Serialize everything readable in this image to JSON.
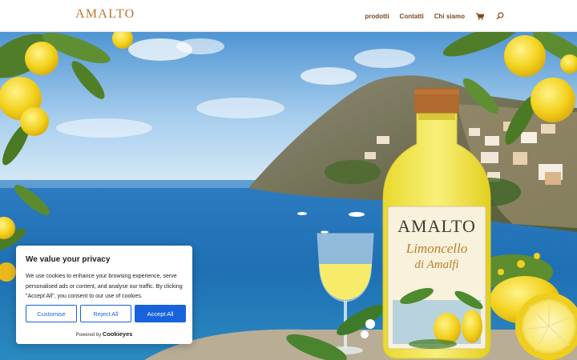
{
  "header": {
    "logo": "AMALTO",
    "nav": [
      {
        "label": "prodotti"
      },
      {
        "label": "Contatti"
      },
      {
        "label": "Chi siamo"
      }
    ],
    "icons": [
      "cart-icon",
      "search-icon"
    ]
  },
  "hero": {
    "bottle_brand": "AMALTO",
    "bottle_line1": "Limoncello",
    "bottle_line2": "di Amalfi"
  },
  "cookie": {
    "title": "We value your privacy",
    "text": "We use cookies to enhance your browsing experience, serve personalised ads or content, and analyse our traffic. By clicking \"Accept All\", you consent to our use of cookies.",
    "customise_label": "Customise",
    "reject_label": "Reject All",
    "accept_label": "Accept All",
    "powered_prefix": "Powered by",
    "powered_brand": "Cookieyes",
    "accent_color": "#1863dc"
  },
  "colors": {
    "brand": "#b9772c",
    "nav_text": "#7a4a20"
  }
}
